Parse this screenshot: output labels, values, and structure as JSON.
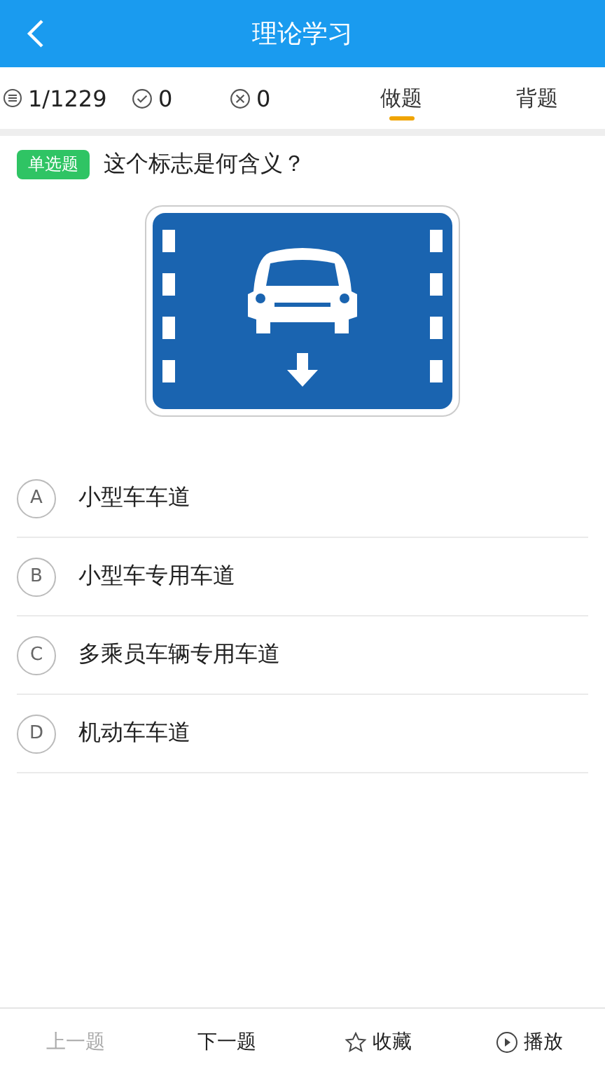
{
  "header": {
    "title": "理论学习"
  },
  "stats": {
    "progress": "1/1229",
    "correct": "0",
    "wrong": "0"
  },
  "modes": [
    {
      "label": "做题",
      "selected": true
    },
    {
      "label": "背题",
      "selected": false
    }
  ],
  "question": {
    "type_tag": "单选题",
    "text": "这个标志是何含义？"
  },
  "options": [
    {
      "letter": "A",
      "text": "小型车车道"
    },
    {
      "letter": "B",
      "text": "小型车专用车道"
    },
    {
      "letter": "C",
      "text": "多乘员车辆专用车道"
    },
    {
      "letter": "D",
      "text": "机动车车道"
    }
  ],
  "bottom_bar": [
    {
      "kind": "text",
      "label": "上一题",
      "disabled": true
    },
    {
      "kind": "text",
      "label": "下一题",
      "disabled": false
    },
    {
      "kind": "star",
      "label": "收藏",
      "disabled": false
    },
    {
      "kind": "play",
      "label": "播放",
      "disabled": false
    }
  ]
}
